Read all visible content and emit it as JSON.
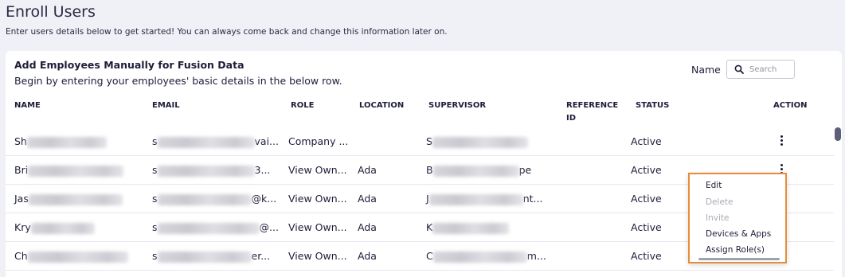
{
  "page": {
    "title": "Enroll Users",
    "subtitle": "Enter users details below to get started! You can always come back and change this information later on."
  },
  "card": {
    "title": "Add Employees Manually for Fusion Data",
    "subtitle": "Begin by entering your employees' basic details in the below row.",
    "name_label": "Name",
    "search_placeholder": "Search"
  },
  "table": {
    "headers": {
      "name": "NAME",
      "email": "EMAIL",
      "role": "ROLE",
      "location": "LOCATION",
      "supervisor": "SUPERVISOR",
      "reference_line1": "REFERENCE",
      "reference_line2": "ID",
      "status": "STATUS",
      "action": "ACTION"
    },
    "rows": [
      {
        "name_prefix": "Sh",
        "email_prefix": "s",
        "email_suffix": "vai...",
        "role": "Company ...",
        "location": "",
        "supervisor_prefix": "S",
        "supervisor_suffix": "",
        "status": "Active"
      },
      {
        "name_prefix": "Bri",
        "email_prefix": "s",
        "email_suffix": "3...",
        "role": "View Own...",
        "location": "Ada",
        "supervisor_prefix": "B",
        "supervisor_suffix": "pe",
        "status": "Active"
      },
      {
        "name_prefix": "Jas",
        "email_prefix": "s",
        "email_suffix": "@k...",
        "role": "View Own...",
        "location": "Ada",
        "supervisor_prefix": "J",
        "supervisor_suffix": "nt...",
        "status": "Active"
      },
      {
        "name_prefix": "Kry",
        "email_prefix": "s",
        "email_suffix": "@...",
        "role": "View Own...",
        "location": "Ada",
        "supervisor_prefix": "K",
        "supervisor_suffix": "",
        "status": "Active"
      },
      {
        "name_prefix": "Ch",
        "email_prefix": "s",
        "email_suffix": "er...",
        "role": "View Own...",
        "location": "Ada",
        "supervisor_prefix": "C",
        "supervisor_suffix": "m...",
        "status": "Active"
      }
    ]
  },
  "action_menu": {
    "items": [
      {
        "label": "Edit",
        "enabled": true
      },
      {
        "label": "Delete",
        "enabled": false
      },
      {
        "label": "Invite",
        "enabled": false
      },
      {
        "label": "Devices & Apps",
        "enabled": true
      },
      {
        "label": "Assign Role(s)",
        "enabled": true
      }
    ],
    "highlight_color": "#e98c3a"
  }
}
